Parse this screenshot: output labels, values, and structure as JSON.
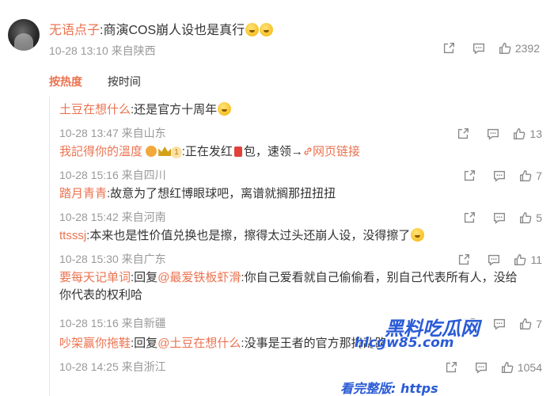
{
  "main_comment": {
    "username": "无语点子",
    "text": ":商演COS崩人设也是真行",
    "time": "10-28 13:10",
    "location": "来自陕西",
    "like_count": "2392"
  },
  "sort_tabs": {
    "hot": "按热度",
    "time": "按时间"
  },
  "replies": [
    {
      "username": "土豆在想什么",
      "text": ":还是官方十周年",
      "time": "10-28 13:47",
      "location": "来自山东",
      "like_count": "13"
    },
    {
      "username": "我記得你的溫度",
      "badge": "1",
      "text_a": ":正在发红",
      "text_b": "包，速领→",
      "link": "网页链接",
      "time": "10-28 15:16",
      "location": "来自四川",
      "like_count": "7"
    },
    {
      "username": "踏月青青",
      "text": ":故意为了想红博眼球吧，离谱就搁那扭扭扭",
      "time": "10-28 15:42",
      "location": "来自河南",
      "like_count": "5"
    },
    {
      "username": "ttsssj",
      "text": ":本来也是性价值兑换也是擦，擦得太过头还崩人设，没得擦了",
      "time": "10-28 15:30",
      "location": "来自广东",
      "like_count": "11"
    },
    {
      "username": "要每天记单词",
      "reply_prefix": ":回复",
      "mention": "@最爱铁板虾滑",
      "text": ":你自己爱看就自己偷偷看，别自己代表所有人，没给你代表的权利哈",
      "time": "10-28 15:16",
      "location": "来自新疆",
      "like_count": "7"
    },
    {
      "username": "吵架赢你拖鞋",
      "reply_prefix": ":回复",
      "mention": "@土豆在想什么",
      "text": ":没事是王者的官方那捣乱",
      "text_tail": "路",
      "time": "10-28 14:25",
      "location": "来自浙江",
      "like_count": "1054"
    }
  ],
  "watermark": {
    "line1": "黑料吃瓜网",
    "line2": "hlcgw85.com",
    "line3": "看完整版: https"
  },
  "colors": {
    "accent": "#eb7350",
    "meta": "#999999",
    "watermark": "#2a5bd7"
  },
  "icons": [
    "share-icon",
    "comment-icon",
    "like-icon"
  ]
}
